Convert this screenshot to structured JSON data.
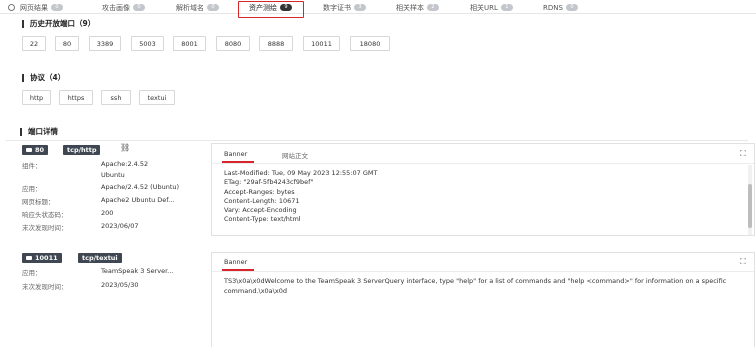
{
  "tabs": [
    {
      "label": "网页结果",
      "count": "0"
    },
    {
      "label": "攻击画像",
      "count": "0"
    },
    {
      "label": "解析域名",
      "count": "0"
    },
    {
      "label": "资产测绘",
      "count": "9"
    },
    {
      "label": "数字证书",
      "count": "3"
    },
    {
      "label": "相关样本",
      "count": "2"
    },
    {
      "label": "相关URL",
      "count": "1"
    },
    {
      "label": "RDNS",
      "count": "0"
    }
  ],
  "active_tab": "资产测绘",
  "open_ports": {
    "title": "历史开放端口（9）",
    "ports": [
      "22",
      "80",
      "3389",
      "5003",
      "8001",
      "8080",
      "8888",
      "10011",
      "18080"
    ]
  },
  "protocols": {
    "title": "协议（4）",
    "items": [
      "http",
      "https",
      "ssh",
      "textui"
    ]
  },
  "port_details": {
    "title": "端口详情",
    "entries": [
      {
        "port": "80",
        "protocol": "tcp/http",
        "fields": [
          {
            "label": "组件：",
            "value": "Apache:2.4.52"
          },
          {
            "label": "",
            "value": "Ubuntu"
          },
          {
            "label": "应用：",
            "value": "Apache/2.4.52 (Ubuntu)"
          },
          {
            "label": "网页标题：",
            "value": "Apache2 Ubuntu Def..."
          },
          {
            "label": "响应头状态码：",
            "value": "200"
          },
          {
            "label": "末次发现时间：",
            "value": "2023/06/07"
          }
        ],
        "panel_tabs": [
          "Banner",
          "网站正文"
        ],
        "banner_lines": [
          "Last-Modified: Tue, 09 May 2023 12:55:07 GMT",
          "ETag: \"29af-5fb4243cf9bef\"",
          "Accept-Ranges: bytes",
          "Content-Length: 10671",
          "Vary: Accept-Encoding",
          "Content-Type: text/html"
        ]
      },
      {
        "port": "10011",
        "protocol": "tcp/textui",
        "fields": [
          {
            "label": "应用：",
            "value": "TeamSpeak 3 Server..."
          },
          {
            "label": "末次发现时间：",
            "value": "2023/05/30"
          }
        ],
        "panel_tabs": [
          "Banner"
        ],
        "banner_text": "TS3\\x0a\\x0dWelcome to the TeamSpeak 3 ServerQuery interface, type \"help\" for a list of commands and \"help <command>\" for information on a specific command.\\x0a\\x0d"
      }
    ]
  },
  "colors": {
    "accent": "#d9242a",
    "badge_dark": "#3f4852"
  },
  "icons": {
    "globe": "globe-icon",
    "camera": "camera-icon",
    "link": "link-icon",
    "expand": "expand-icon"
  }
}
